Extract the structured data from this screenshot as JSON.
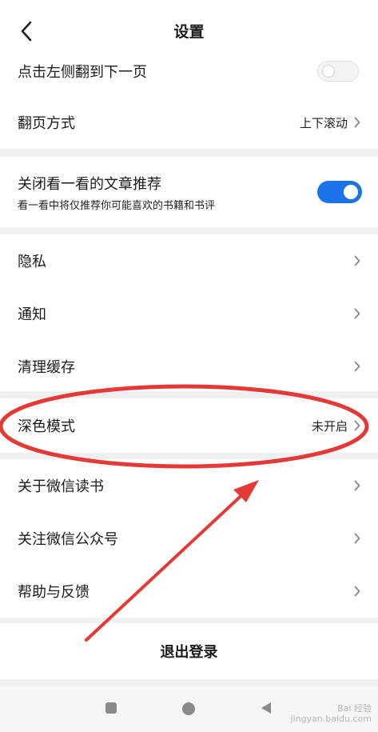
{
  "header": {
    "title": "设置"
  },
  "group1": {
    "rows": [
      {
        "label": "点击左侧翻到下一页",
        "toggle": "off"
      },
      {
        "label": "翻页方式",
        "value": "上下滚动"
      }
    ]
  },
  "group2": {
    "rows": [
      {
        "label": "关闭看一看的文章推荐",
        "sublabel": "看一看中将仅推荐你可能喜欢的书籍和书评",
        "toggle": "on"
      }
    ]
  },
  "group3": {
    "rows": [
      {
        "label": "隐私"
      },
      {
        "label": "通知"
      },
      {
        "label": "清理缓存"
      }
    ]
  },
  "group4": {
    "rows": [
      {
        "label": "深色模式",
        "value": "未开启"
      }
    ]
  },
  "group5": {
    "rows": [
      {
        "label": "关于微信读书"
      },
      {
        "label": "关注微信公众号"
      },
      {
        "label": "帮助与反馈"
      }
    ]
  },
  "logout": {
    "label": "退出登录"
  },
  "colors": {
    "accent": "#1a73e8",
    "annotation": "#e53935",
    "background": "#eef0f2"
  },
  "icons": {
    "back": "chevron-left-icon",
    "row": "chevron-right-icon",
    "nav": [
      "square-icon",
      "circle-icon",
      "triangle-back-icon"
    ]
  },
  "watermark": {
    "line1": "Bai 经验",
    "line2": "jingyan.baidu.com"
  }
}
